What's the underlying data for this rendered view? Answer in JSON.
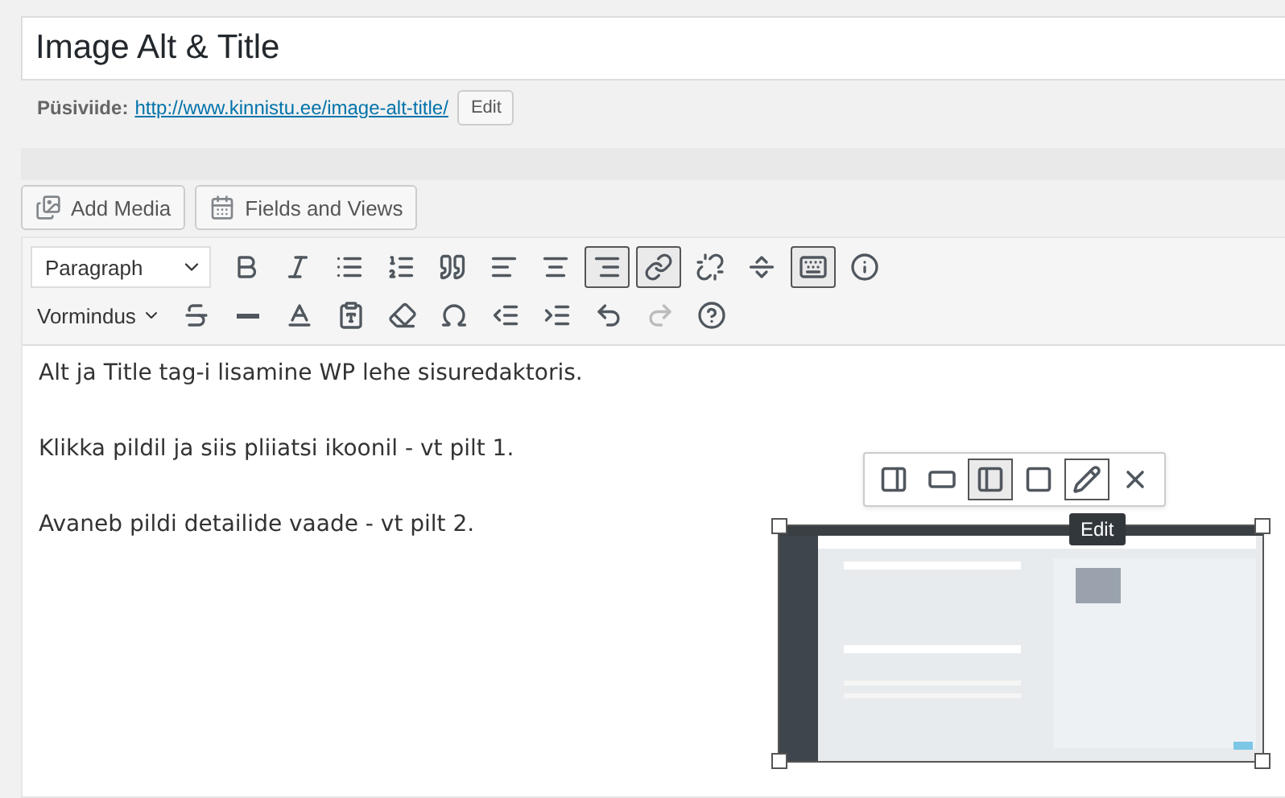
{
  "title_field": {
    "value": "Image Alt & Title"
  },
  "permalink": {
    "label": "Püsiviide:",
    "url": "http://www.kinnistu.ee/image-alt-title/",
    "edit_button": "Edit"
  },
  "media_buttons": [
    "Add Media",
    "Fields and Views"
  ],
  "toolbar_row_1": {
    "format_select": "Paragraph",
    "buttons": [
      {
        "selected": false
      },
      {
        "selected": false
      },
      {
        "selected": false
      },
      {
        "selected": false
      },
      {
        "selected": false
      },
      {
        "selected": false
      },
      {
        "selected": false
      },
      {
        "selected": true
      },
      {
        "selected": true
      },
      {
        "selected": false
      },
      {
        "selected": false
      },
      {
        "selected": true
      },
      {
        "selected": false
      }
    ]
  },
  "toolbar_row_2": {
    "format_menu": "Vormindus",
    "buttons": [
      {
        "disabled": false
      },
      {
        "disabled": false
      },
      {
        "disabled": false
      },
      {
        "disabled": false
      },
      {
        "disabled": false
      },
      {
        "disabled": false
      },
      {
        "disabled": false
      },
      {
        "disabled": false
      },
      {
        "disabled": false
      },
      {
        "disabled": true
      },
      {
        "disabled": false
      }
    ]
  },
  "content": {
    "paragraphs": [
      "Alt ja Title tag-i lisamine WP lehe sisuredaktoris.",
      "Klikka pildil ja siis pliiatsi ikoonil - vt pilt 1.",
      "Avaneb pildi detailide vaade - vt pilt 2."
    ]
  },
  "image_toolbar": {
    "buttons": [
      {
        "selected": false,
        "hovered": false
      },
      {
        "selected": false,
        "hovered": false
      },
      {
        "selected": true,
        "hovered": false
      },
      {
        "selected": false,
        "hovered": false
      },
      {
        "selected": false,
        "hovered": true
      },
      {
        "selected": false,
        "hovered": false
      }
    ],
    "tooltip": "Edit"
  },
  "image": {
    "kind": "picture"
  }
}
